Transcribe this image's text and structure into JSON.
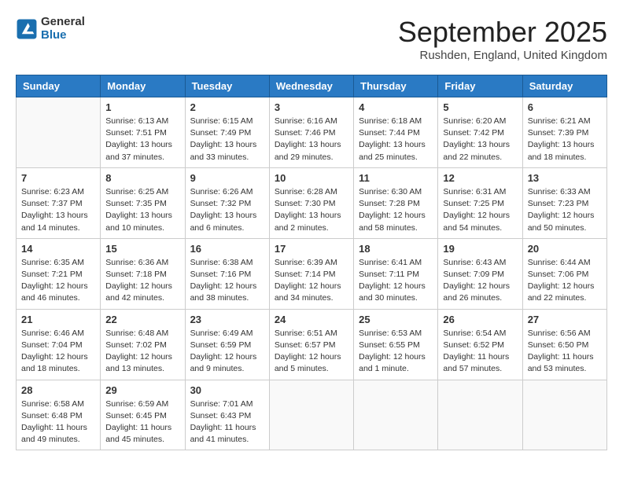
{
  "header": {
    "logo_general": "General",
    "logo_blue": "Blue",
    "month": "September 2025",
    "location": "Rushden, England, United Kingdom"
  },
  "days_of_week": [
    "Sunday",
    "Monday",
    "Tuesday",
    "Wednesday",
    "Thursday",
    "Friday",
    "Saturday"
  ],
  "weeks": [
    [
      {
        "day": "",
        "info": ""
      },
      {
        "day": "1",
        "info": "Sunrise: 6:13 AM\nSunset: 7:51 PM\nDaylight: 13 hours\nand 37 minutes."
      },
      {
        "day": "2",
        "info": "Sunrise: 6:15 AM\nSunset: 7:49 PM\nDaylight: 13 hours\nand 33 minutes."
      },
      {
        "day": "3",
        "info": "Sunrise: 6:16 AM\nSunset: 7:46 PM\nDaylight: 13 hours\nand 29 minutes."
      },
      {
        "day": "4",
        "info": "Sunrise: 6:18 AM\nSunset: 7:44 PM\nDaylight: 13 hours\nand 25 minutes."
      },
      {
        "day": "5",
        "info": "Sunrise: 6:20 AM\nSunset: 7:42 PM\nDaylight: 13 hours\nand 22 minutes."
      },
      {
        "day": "6",
        "info": "Sunrise: 6:21 AM\nSunset: 7:39 PM\nDaylight: 13 hours\nand 18 minutes."
      }
    ],
    [
      {
        "day": "7",
        "info": "Sunrise: 6:23 AM\nSunset: 7:37 PM\nDaylight: 13 hours\nand 14 minutes."
      },
      {
        "day": "8",
        "info": "Sunrise: 6:25 AM\nSunset: 7:35 PM\nDaylight: 13 hours\nand 10 minutes."
      },
      {
        "day": "9",
        "info": "Sunrise: 6:26 AM\nSunset: 7:32 PM\nDaylight: 13 hours\nand 6 minutes."
      },
      {
        "day": "10",
        "info": "Sunrise: 6:28 AM\nSunset: 7:30 PM\nDaylight: 13 hours\nand 2 minutes."
      },
      {
        "day": "11",
        "info": "Sunrise: 6:30 AM\nSunset: 7:28 PM\nDaylight: 12 hours\nand 58 minutes."
      },
      {
        "day": "12",
        "info": "Sunrise: 6:31 AM\nSunset: 7:25 PM\nDaylight: 12 hours\nand 54 minutes."
      },
      {
        "day": "13",
        "info": "Sunrise: 6:33 AM\nSunset: 7:23 PM\nDaylight: 12 hours\nand 50 minutes."
      }
    ],
    [
      {
        "day": "14",
        "info": "Sunrise: 6:35 AM\nSunset: 7:21 PM\nDaylight: 12 hours\nand 46 minutes."
      },
      {
        "day": "15",
        "info": "Sunrise: 6:36 AM\nSunset: 7:18 PM\nDaylight: 12 hours\nand 42 minutes."
      },
      {
        "day": "16",
        "info": "Sunrise: 6:38 AM\nSunset: 7:16 PM\nDaylight: 12 hours\nand 38 minutes."
      },
      {
        "day": "17",
        "info": "Sunrise: 6:39 AM\nSunset: 7:14 PM\nDaylight: 12 hours\nand 34 minutes."
      },
      {
        "day": "18",
        "info": "Sunrise: 6:41 AM\nSunset: 7:11 PM\nDaylight: 12 hours\nand 30 minutes."
      },
      {
        "day": "19",
        "info": "Sunrise: 6:43 AM\nSunset: 7:09 PM\nDaylight: 12 hours\nand 26 minutes."
      },
      {
        "day": "20",
        "info": "Sunrise: 6:44 AM\nSunset: 7:06 PM\nDaylight: 12 hours\nand 22 minutes."
      }
    ],
    [
      {
        "day": "21",
        "info": "Sunrise: 6:46 AM\nSunset: 7:04 PM\nDaylight: 12 hours\nand 18 minutes."
      },
      {
        "day": "22",
        "info": "Sunrise: 6:48 AM\nSunset: 7:02 PM\nDaylight: 12 hours\nand 13 minutes."
      },
      {
        "day": "23",
        "info": "Sunrise: 6:49 AM\nSunset: 6:59 PM\nDaylight: 12 hours\nand 9 minutes."
      },
      {
        "day": "24",
        "info": "Sunrise: 6:51 AM\nSunset: 6:57 PM\nDaylight: 12 hours\nand 5 minutes."
      },
      {
        "day": "25",
        "info": "Sunrise: 6:53 AM\nSunset: 6:55 PM\nDaylight: 12 hours\nand 1 minute."
      },
      {
        "day": "26",
        "info": "Sunrise: 6:54 AM\nSunset: 6:52 PM\nDaylight: 11 hours\nand 57 minutes."
      },
      {
        "day": "27",
        "info": "Sunrise: 6:56 AM\nSunset: 6:50 PM\nDaylight: 11 hours\nand 53 minutes."
      }
    ],
    [
      {
        "day": "28",
        "info": "Sunrise: 6:58 AM\nSunset: 6:48 PM\nDaylight: 11 hours\nand 49 minutes."
      },
      {
        "day": "29",
        "info": "Sunrise: 6:59 AM\nSunset: 6:45 PM\nDaylight: 11 hours\nand 45 minutes."
      },
      {
        "day": "30",
        "info": "Sunrise: 7:01 AM\nSunset: 6:43 PM\nDaylight: 11 hours\nand 41 minutes."
      },
      {
        "day": "",
        "info": ""
      },
      {
        "day": "",
        "info": ""
      },
      {
        "day": "",
        "info": ""
      },
      {
        "day": "",
        "info": ""
      }
    ]
  ]
}
